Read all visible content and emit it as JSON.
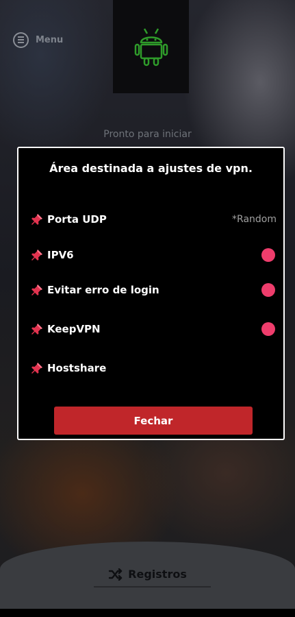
{
  "header": {
    "menu_label": "Menu",
    "logo_icon": "android-icon",
    "status_text": "Pronto para iniciar"
  },
  "dialog": {
    "title": "Área destinada a ajustes de vpn.",
    "rows": [
      {
        "label": "Porta UDP",
        "value": "*Random",
        "icon": "pushpin-icon"
      },
      {
        "label": "IPV6",
        "toggle": true,
        "icon": "pushpin-icon"
      },
      {
        "label": "Evitar erro de login",
        "toggle": true,
        "icon": "pushpin-icon"
      },
      {
        "label": "KeepVPN",
        "toggle": true,
        "icon": "pushpin-icon"
      },
      {
        "label": "Hostshare",
        "icon": "pushpin-icon"
      }
    ],
    "close_label": "Fechar"
  },
  "bottom": {
    "logs_label": "Registros",
    "logs_icon": "shuffle-icon"
  },
  "colors": {
    "accent_button": "#c0262a",
    "toggle_dot": "#ee3d6c",
    "android_green": "#2f9c2a"
  }
}
